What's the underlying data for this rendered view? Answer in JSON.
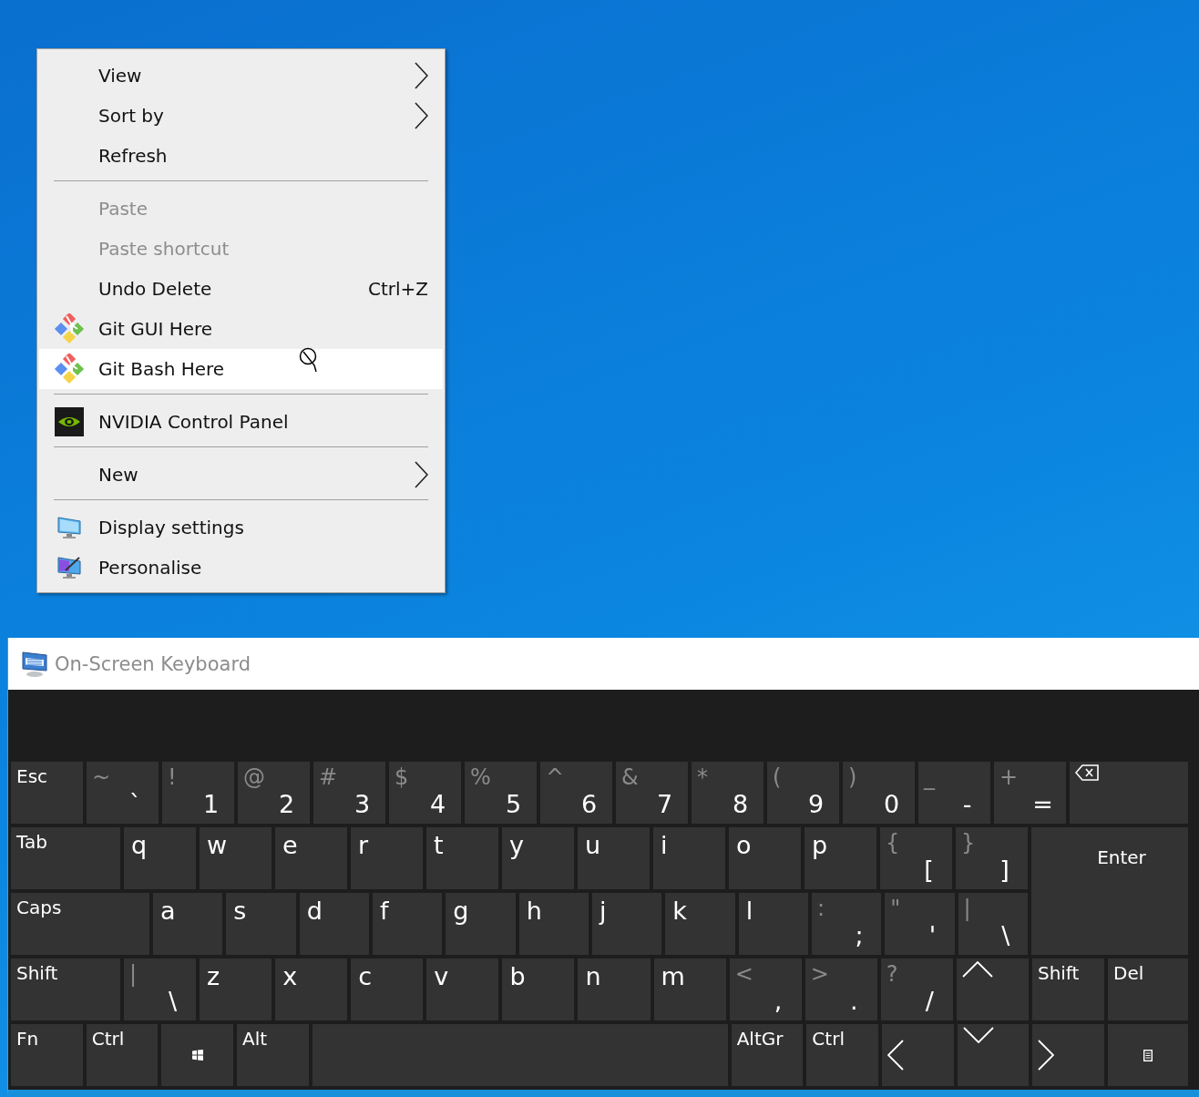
{
  "context_menu": {
    "items": [
      {
        "kind": "item",
        "label": "View",
        "disabled": false,
        "submenu": true,
        "selected": false
      },
      {
        "kind": "item",
        "label": "Sort by",
        "disabled": false,
        "submenu": true,
        "selected": false
      },
      {
        "kind": "item",
        "label": "Refresh",
        "disabled": false,
        "submenu": false,
        "selected": false
      },
      {
        "kind": "separator"
      },
      {
        "kind": "item",
        "label": "Paste",
        "disabled": true,
        "submenu": false,
        "selected": false
      },
      {
        "kind": "item",
        "label": "Paste shortcut",
        "disabled": true,
        "submenu": false,
        "selected": false
      },
      {
        "kind": "item",
        "label": "Undo Delete",
        "shortcut": "Ctrl+Z",
        "disabled": false,
        "submenu": false,
        "selected": false
      },
      {
        "kind": "item",
        "label": "Git GUI Here",
        "disabled": false,
        "submenu": false,
        "selected": false
      },
      {
        "kind": "item",
        "label": "Git Bash Here",
        "disabled": false,
        "submenu": false,
        "selected": true
      },
      {
        "kind": "separator"
      },
      {
        "kind": "item",
        "label": "NVIDIA Control Panel",
        "disabled": false,
        "submenu": false,
        "selected": false
      },
      {
        "kind": "separator"
      },
      {
        "kind": "item",
        "label": "New",
        "disabled": false,
        "submenu": true,
        "selected": false
      },
      {
        "kind": "separator"
      },
      {
        "kind": "item",
        "label": "Display settings",
        "disabled": false,
        "submenu": false,
        "selected": false
      },
      {
        "kind": "item",
        "label": "Personalise",
        "disabled": false,
        "submenu": false,
        "selected": false
      }
    ]
  },
  "keyboard": {
    "window": {
      "title": "On-Screen Keyboard"
    },
    "number_row": [
      {
        "kind": "word",
        "main": "Esc"
      },
      {
        "kind": "symbol",
        "shift": "~",
        "main": "`"
      },
      {
        "kind": "symbol",
        "shift": "!",
        "main": "1"
      },
      {
        "kind": "symbol",
        "shift": "@",
        "main": "2"
      },
      {
        "kind": "symbol",
        "shift": "#",
        "main": "3"
      },
      {
        "kind": "symbol",
        "shift": "$",
        "main": "4"
      },
      {
        "kind": "symbol",
        "shift": "%",
        "main": "5"
      },
      {
        "kind": "symbol",
        "shift": "^",
        "main": "6"
      },
      {
        "kind": "symbol",
        "shift": "&",
        "main": "7"
      },
      {
        "kind": "symbol",
        "shift": "*",
        "main": "8"
      },
      {
        "kind": "symbol",
        "shift": "(",
        "main": "9"
      },
      {
        "kind": "symbol",
        "shift": ")",
        "main": "0"
      },
      {
        "kind": "symbol",
        "shift": "_",
        "main": "-"
      },
      {
        "kind": "symbol",
        "shift": "+",
        "main": "="
      },
      {
        "kind": "backspace"
      }
    ],
    "top_row": [
      {
        "kind": "word",
        "main": "Tab"
      },
      {
        "kind": "letter",
        "main": "q"
      },
      {
        "kind": "letter",
        "main": "w"
      },
      {
        "kind": "letter",
        "main": "e"
      },
      {
        "kind": "letter",
        "main": "r"
      },
      {
        "kind": "letter",
        "main": "t"
      },
      {
        "kind": "letter",
        "main": "y"
      },
      {
        "kind": "letter",
        "main": "u"
      },
      {
        "kind": "letter",
        "main": "i"
      },
      {
        "kind": "letter",
        "main": "o"
      },
      {
        "kind": "letter",
        "main": "p"
      },
      {
        "kind": "symbol",
        "shift": "{",
        "main": "["
      },
      {
        "kind": "symbol",
        "shift": "}",
        "main": "]"
      }
    ],
    "home_row": [
      {
        "kind": "word",
        "main": "Caps"
      },
      {
        "kind": "letter",
        "main": "a"
      },
      {
        "kind": "letter",
        "main": "s"
      },
      {
        "kind": "letter",
        "main": "d"
      },
      {
        "kind": "letter",
        "main": "f"
      },
      {
        "kind": "letter",
        "main": "g"
      },
      {
        "kind": "letter",
        "main": "h"
      },
      {
        "kind": "letter",
        "main": "j"
      },
      {
        "kind": "letter",
        "main": "k"
      },
      {
        "kind": "letter",
        "main": "l"
      },
      {
        "kind": "symbol",
        "shift": ":",
        "main": ";"
      },
      {
        "kind": "symbol",
        "shift": "\"",
        "main": "'"
      },
      {
        "kind": "symbol",
        "shift": "|",
        "main": "\\"
      }
    ],
    "shift_row": [
      {
        "kind": "word",
        "main": "Shift"
      },
      {
        "kind": "symbol",
        "shift": "|",
        "main": "\\"
      },
      {
        "kind": "letter",
        "main": "z"
      },
      {
        "kind": "letter",
        "main": "x"
      },
      {
        "kind": "letter",
        "main": "c"
      },
      {
        "kind": "letter",
        "main": "v"
      },
      {
        "kind": "letter",
        "main": "b"
      },
      {
        "kind": "letter",
        "main": "n"
      },
      {
        "kind": "letter",
        "main": "m"
      },
      {
        "kind": "symbol",
        "shift": "<",
        "main": ","
      },
      {
        "kind": "symbol",
        "shift": ">",
        "main": "."
      },
      {
        "kind": "symbol",
        "shift": "?",
        "main": "/"
      },
      {
        "kind": "up"
      },
      {
        "kind": "word",
        "main": "Shift"
      },
      {
        "kind": "word",
        "main": "Del"
      }
    ],
    "modifier_row": [
      {
        "kind": "word",
        "main": "Fn"
      },
      {
        "kind": "word",
        "main": "Ctrl"
      },
      {
        "kind": "windows"
      },
      {
        "kind": "word",
        "main": "Alt"
      },
      {
        "kind": "space"
      },
      {
        "kind": "word",
        "main": "AltGr"
      },
      {
        "kind": "word",
        "main": "Ctrl"
      },
      {
        "kind": "left"
      },
      {
        "kind": "down"
      },
      {
        "kind": "right"
      },
      {
        "kind": "menu"
      }
    ],
    "enter_key": {
      "kind": "enter",
      "main": "Enter"
    }
  }
}
